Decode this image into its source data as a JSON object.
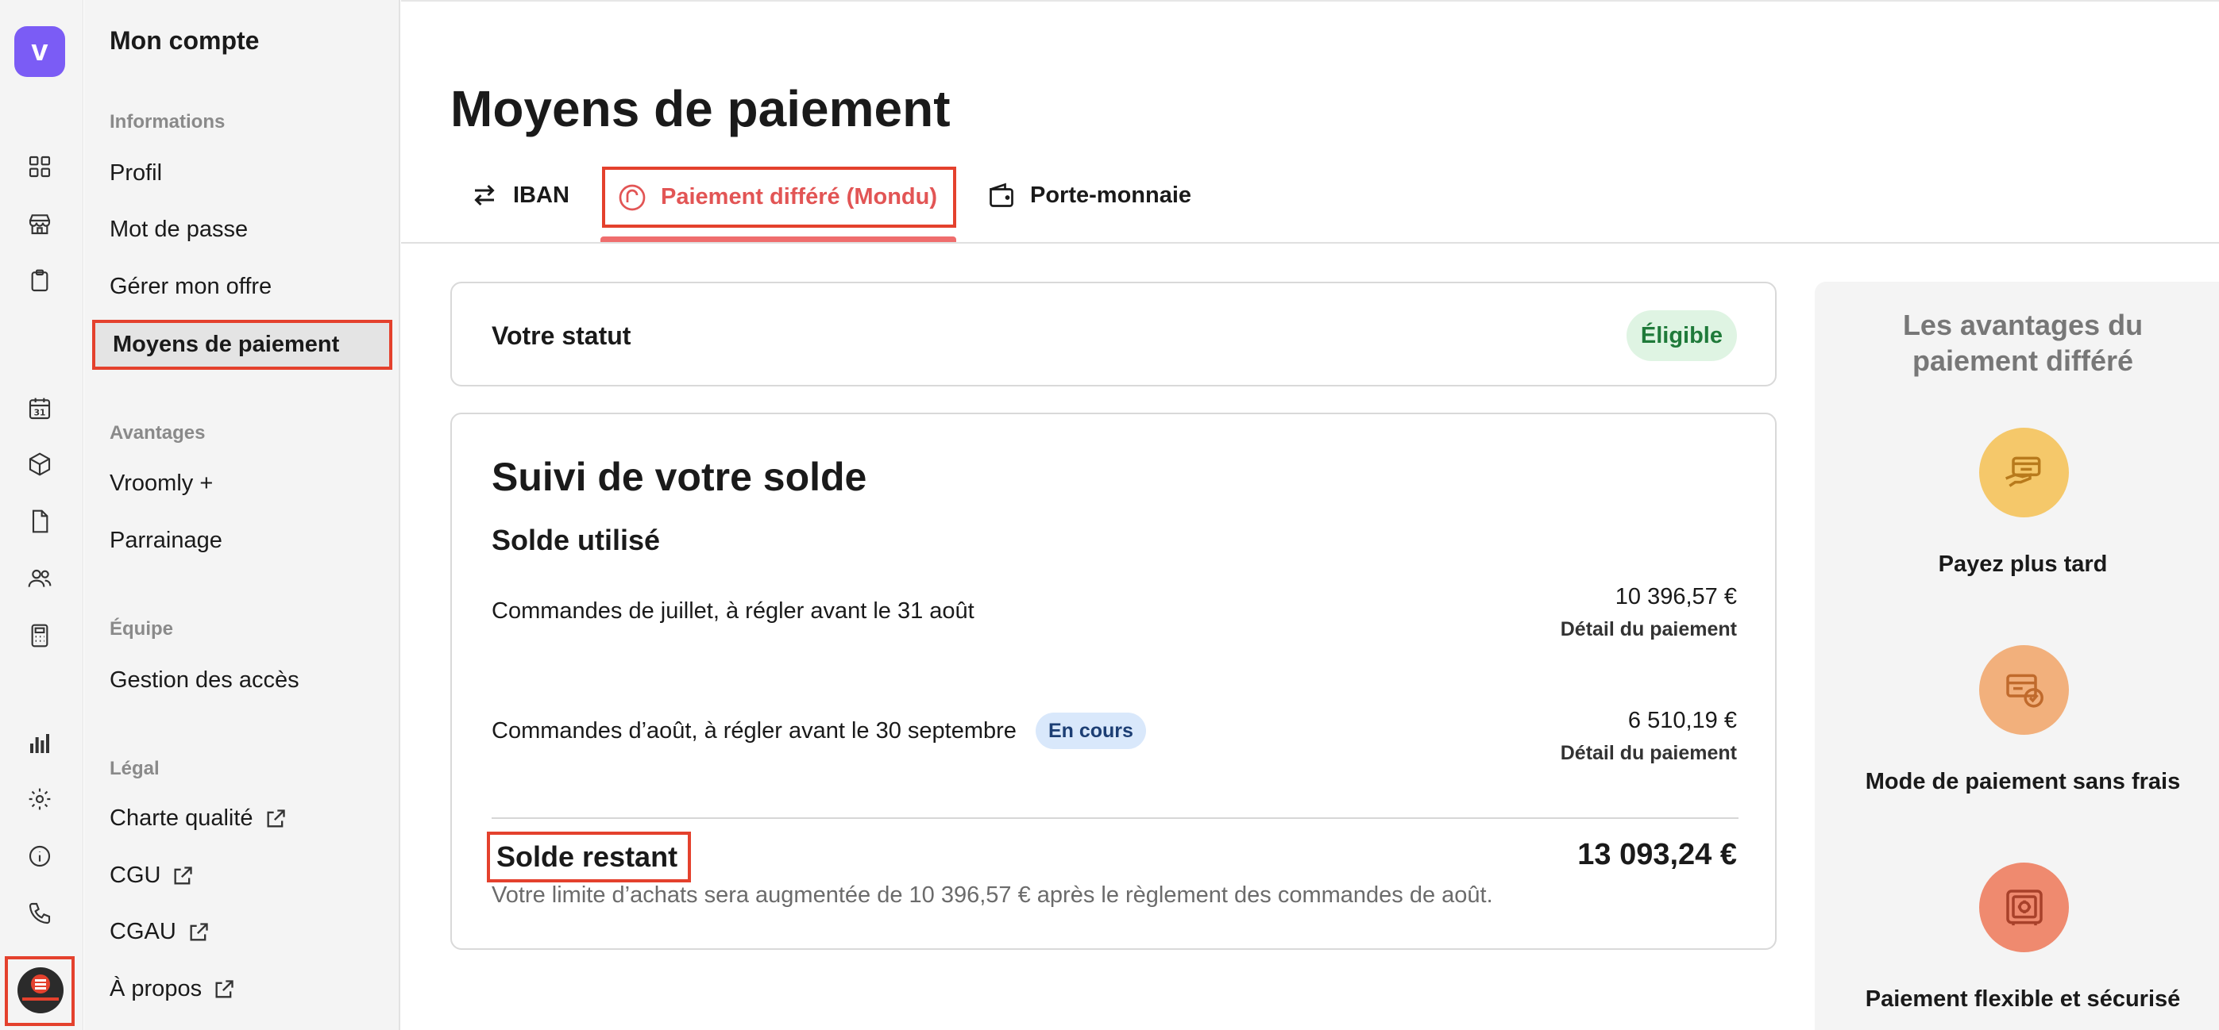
{
  "app": {
    "logo_letter": "v",
    "brand_color": "#7b5cf5",
    "alert_color": "#e4412d"
  },
  "rail": {
    "icons": [
      "grid-icon",
      "store-icon",
      "clipboard-icon",
      "calendar-icon",
      "box-icon",
      "document-icon",
      "users-icon",
      "calculator-icon",
      "bar-chart-icon",
      "gear-icon",
      "info-icon",
      "phone-icon"
    ],
    "calendar_number": "31"
  },
  "sidebar": {
    "title": "Mon compte",
    "sections": [
      {
        "label": "Informations",
        "items": [
          "Profil",
          "Mot de passe",
          "Gérer mon offre",
          "Moyens de paiement"
        ]
      },
      {
        "label": "Avantages",
        "items": [
          "Vroomly +",
          "Parrainage"
        ]
      },
      {
        "label": "Équipe",
        "items": [
          "Gestion des accès"
        ]
      },
      {
        "label": "Légal",
        "items": [
          "Charte qualité",
          "CGU",
          "CGAU",
          "À propos"
        ]
      }
    ],
    "active_item": "Moyens de paiement"
  },
  "page": {
    "title": "Moyens de paiement",
    "tabs": [
      {
        "label": "IBAN",
        "icon": "swap-arrows-icon"
      },
      {
        "label": "Paiement différé (Mondu)",
        "icon": "mondu-icon",
        "active": true
      },
      {
        "label": "Porte-monnaie",
        "icon": "wallet-icon"
      }
    ]
  },
  "status": {
    "label": "Votre statut",
    "badge": "Éligible"
  },
  "balance": {
    "title": "Suivi de votre solde",
    "subtitle": "Solde utilisé",
    "rows": [
      {
        "label": "Commandes de juillet, à régler avant le 31 août",
        "badge": "",
        "amount": "10 396,57 €",
        "detail": "Détail du paiement"
      },
      {
        "label": "Commandes d’août, à régler avant le 30 septembre",
        "badge": "En cours",
        "amount": "6 510,19 €",
        "detail": "Détail du paiement"
      }
    ],
    "remaining_label": "Solde restant",
    "remaining_amount": "13 093,24 €",
    "note": "Votre limite d’achats sera augmentée de 10 396,57 € après le règlement des commandes de août."
  },
  "advantages": {
    "title_line1": "Les avantages du",
    "title_line2": "paiement différé",
    "items": [
      {
        "label": "Payez plus tard",
        "icon": "card-hand-icon",
        "color": "#f5c86a"
      },
      {
        "label": "Mode de paiement sans frais",
        "icon": "invoice-check-icon",
        "color": "#f2b07c"
      },
      {
        "label": "Paiement flexible et sécurisé",
        "icon": "safe-icon",
        "color": "#ef8a6f"
      }
    ]
  }
}
